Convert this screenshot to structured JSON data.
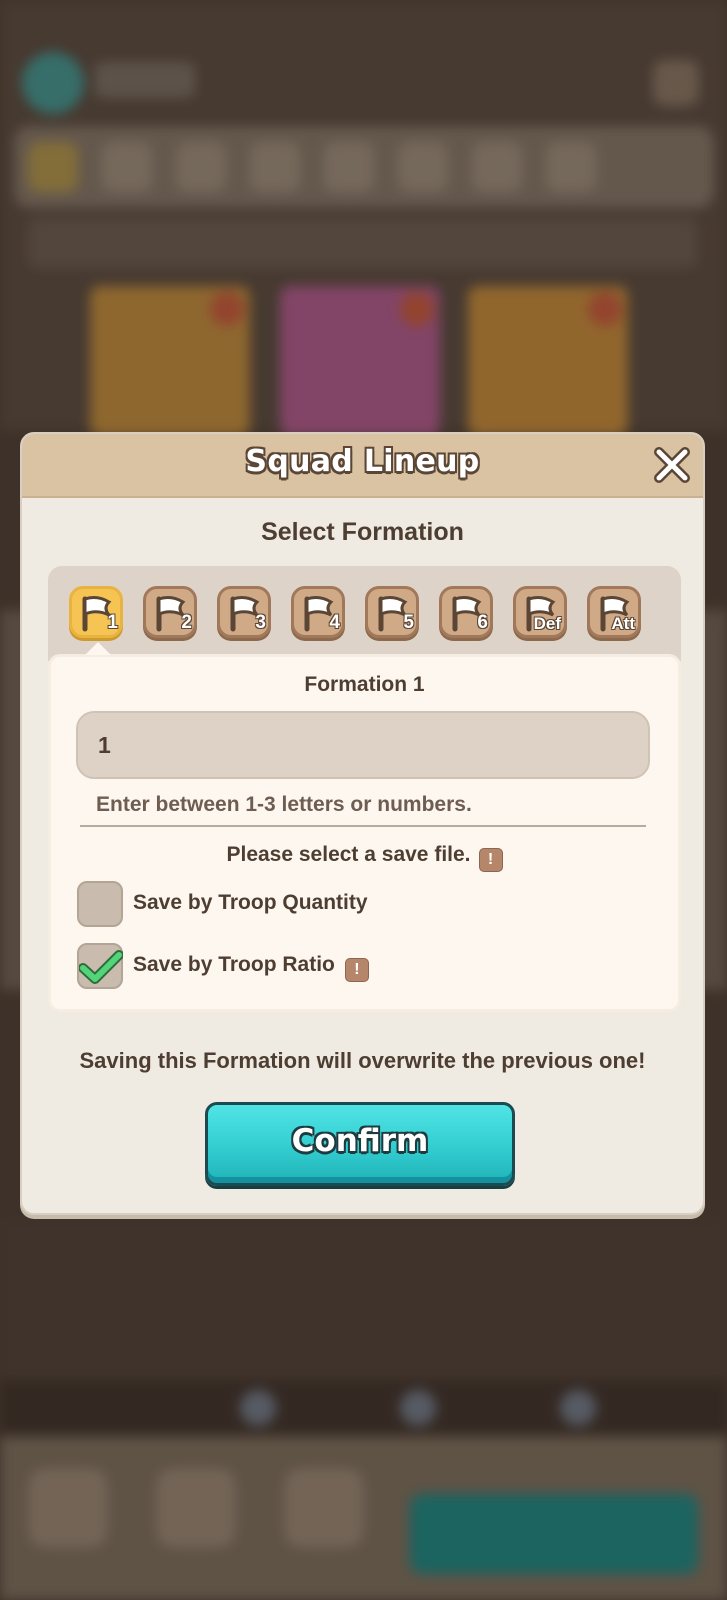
{
  "modal": {
    "title": "Squad Lineup",
    "subtitle": "Select Formation",
    "tabs": [
      {
        "label": "1",
        "active": true
      },
      {
        "label": "2",
        "active": false
      },
      {
        "label": "3",
        "active": false
      },
      {
        "label": "4",
        "active": false
      },
      {
        "label": "5",
        "active": false
      },
      {
        "label": "6",
        "active": false
      },
      {
        "label": "Def",
        "active": false
      },
      {
        "label": "Att",
        "active": false
      }
    ],
    "formation_name": "Formation 1",
    "name_input": {
      "value": "1"
    },
    "hint": "Enter between 1-3 letters or numbers.",
    "save_prompt": "Please select a save file.",
    "info_icon_glyph": "!",
    "options": [
      {
        "label": "Save by Troop Quantity",
        "checked": false
      },
      {
        "label": "Save by Troop Ratio",
        "checked": true
      }
    ],
    "warning": "Saving this Formation will overwrite the previous one!",
    "confirm_label": "Confirm"
  },
  "icons": {
    "close": "close-icon",
    "flag": "flag-icon",
    "info": "info-icon",
    "check": "checkmark-icon"
  },
  "colors": {
    "accent_cyan": "#33cdd0",
    "active_tab": "#f5c453",
    "header": "#d9c3a3",
    "text_dark": "#4e3e32"
  }
}
